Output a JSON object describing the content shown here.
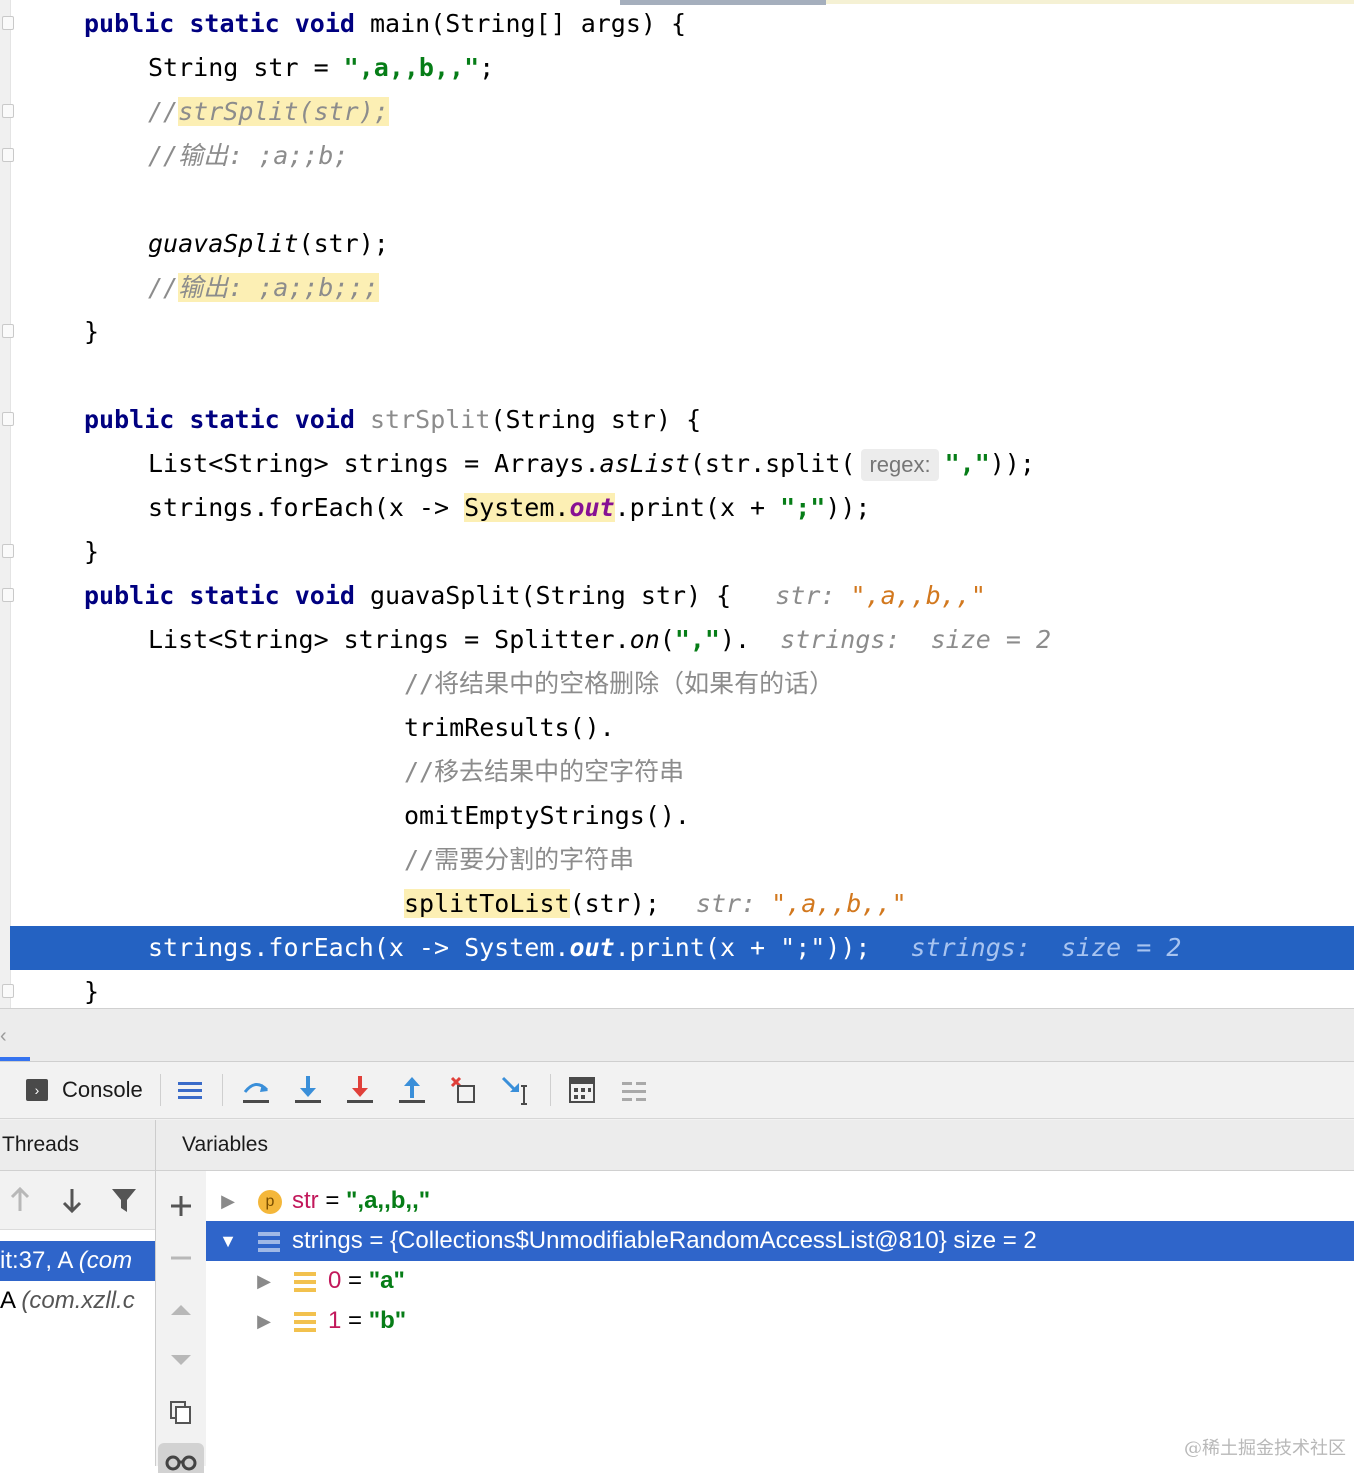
{
  "editor": {
    "lines": {
      "main_sig_kw": "public static void",
      "main_sig_rest": " main(String[] args) {",
      "str_decl_a": "String str = ",
      "str_decl_val": "\",a,,b,,\"",
      "str_decl_end": ";",
      "cm1_prefix": "//",
      "cm1_body": "strSplit(str);",
      "cm2": "//输出: ;a;;b;",
      "guava_call_name": "guavaSplit",
      "guava_call_rest": "(str);",
      "cm3_prefix": "//",
      "cm3_body": "输出: ;a;;b;;;",
      "close1": "}",
      "strsplit_sig_kw": "public static void",
      "strsplit_sig_name": " strSplit",
      "strsplit_sig_rest": "(String str) {",
      "list_decl_a": "List<String> strings = Arrays.",
      "list_decl_aslist": "asList",
      "list_decl_b": "(str.split(",
      "regex_hint": "regex:",
      "list_decl_str": "\",\"",
      "list_decl_end": "));",
      "foreach_a": "strings.forEach(x -> ",
      "foreach_sys": "System.",
      "foreach_out": "out",
      "foreach_b": ".print(x + ",
      "foreach_str": "\";\"",
      "foreach_end": "));",
      "close2": "}",
      "guava_sig_kw": "public static void",
      "guava_sig_rest": " guavaSplit(String str) {",
      "guava_hint_label": "str: ",
      "guava_hint_val": "\",a,,b,,\"",
      "splitter_a": "List<String> strings = Splitter.",
      "splitter_on": "on",
      "splitter_b": "(",
      "splitter_str": "\",\"",
      "splitter_c": ").",
      "splitter_hint": "strings:  size = 2",
      "cm4": "//将结果中的空格删除（如果有的话）",
      "trim": "trimResults().",
      "cm5": "//移去结果中的空字符串",
      "omit": "omitEmptyStrings().",
      "cm6": "//需要分割的字符串",
      "split_to_list": "splitToList",
      "split_rest": "(str);",
      "split_hint_label": "str: ",
      "split_hint_val": "\",a,,b,,\"",
      "exec_a": "strings.forEach(x -> System.",
      "exec_out": "out",
      "exec_b": ".print(x + \";\"));",
      "exec_hint": "strings:  size = 2",
      "close3": "}"
    }
  },
  "debugger": {
    "console_label": "Console",
    "threads_label": "Threads",
    "variables_label": "Variables",
    "frames": [
      {
        "text": "it:37, A ",
        "pkg": "(com"
      },
      {
        "text": "A ",
        "pkg": "(com.xzll.c"
      }
    ],
    "variables": [
      {
        "name": "str",
        "eq": " = ",
        "value": "\",a,,b,,\""
      },
      {
        "name": "strings",
        "rest": " = {Collections$UnmodifiableRandomAccessList@810}  size = 2"
      },
      {
        "name": "0",
        "eq": " = ",
        "value": "\"a\""
      },
      {
        "name": "1",
        "eq": " = ",
        "value": "\"b\""
      }
    ],
    "toolbar_icons": [
      "console-icon",
      "list-icon",
      "step-over-icon",
      "step-into-icon",
      "force-step-into-icon",
      "step-out-icon",
      "drop-frame-icon",
      "run-to-cursor-icon",
      "evaluate-icon",
      "trace-icon"
    ],
    "accent": "#2f65ca"
  },
  "watermark": "@稀土掘金技术社区"
}
